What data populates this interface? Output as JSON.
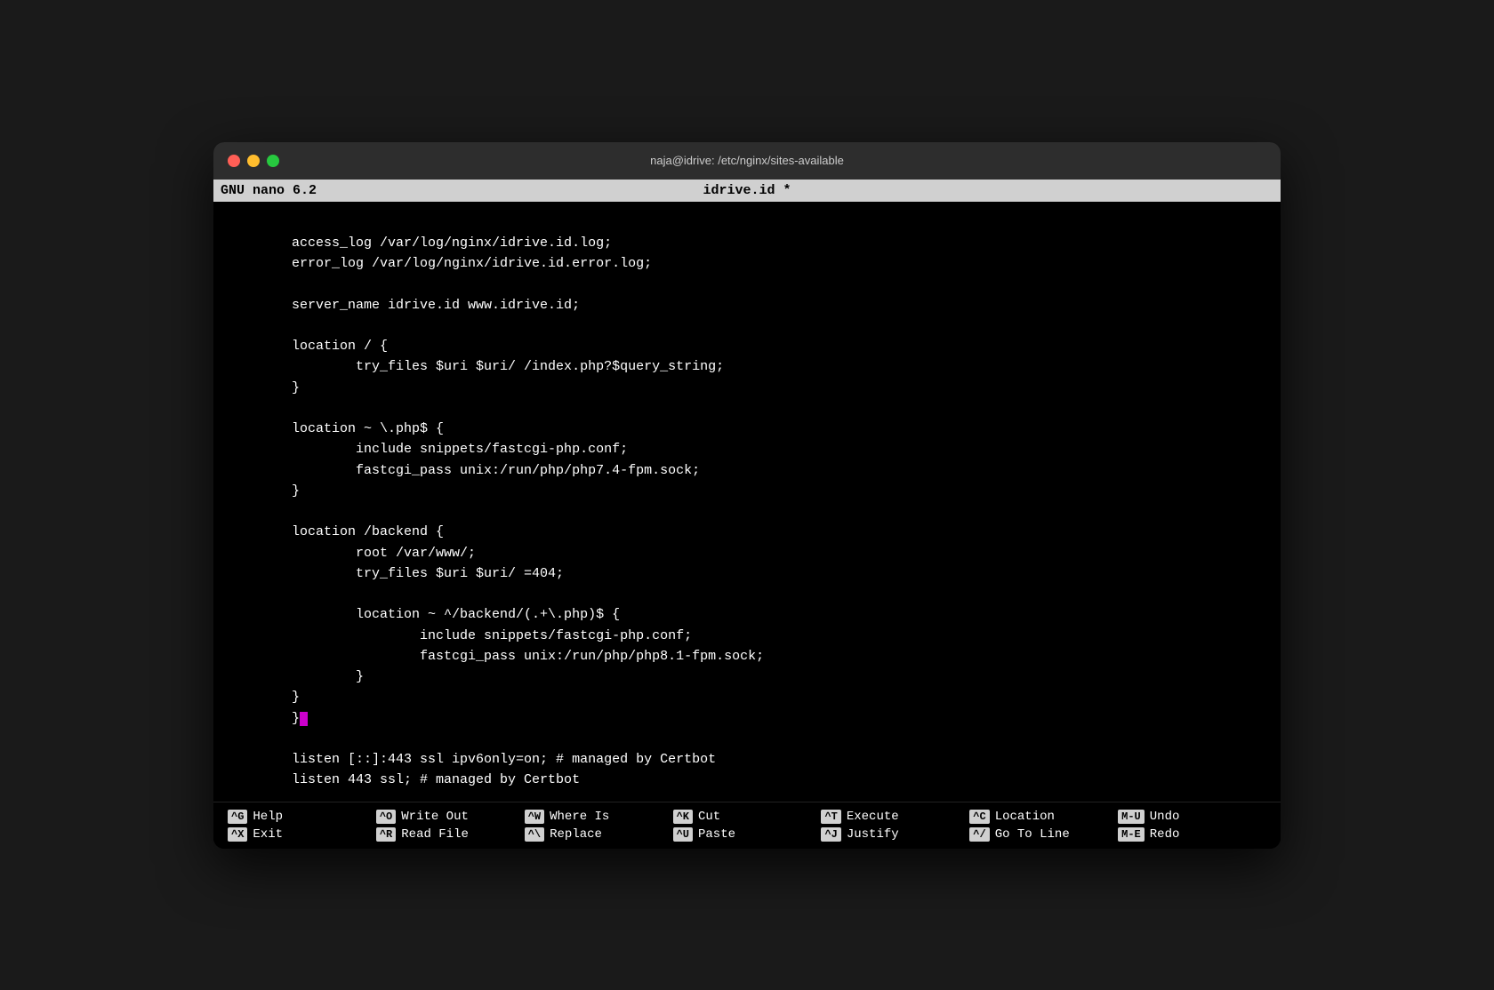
{
  "window": {
    "title": "naja@idrive: /etc/nginx/sites-available",
    "traffic_lights": [
      "close",
      "minimize",
      "maximize"
    ]
  },
  "nano_header": {
    "left": "GNU nano 6.2",
    "center": "idrive.id *",
    "right": ""
  },
  "editor": {
    "lines": [
      "        access_log /var/log/nginx/idrive.id.log;",
      "        error_log /var/log/nginx/idrive.id.error.log;",
      "",
      "        server_name idrive.id www.idrive.id;",
      "",
      "        location / {",
      "                try_files $uri $uri/ /index.php?$query_string;",
      "        }",
      "",
      "        location ~ \\.php$ {",
      "                include snippets/fastcgi-php.conf;",
      "                fastcgi_pass unix:/run/php/php7.4-fpm.sock;",
      "        }",
      "",
      "        location /backend {",
      "                root /var/www/;",
      "                try_files $uri $uri/ =404;",
      "",
      "                location ~ ^/backend/(.+\\.php)$ {",
      "                        include snippets/fastcgi-php.conf;",
      "                        fastcgi_pass unix:/run/php/php8.1-fpm.sock;",
      "                }",
      "        }"
    ],
    "cursor_line": "        }",
    "cursor_after": "}",
    "after_cursor_lines": [
      "",
      "        listen [::]:443 ssl ipv6only=on; # managed by Certbot",
      "        listen 443 ssl; # managed by Certbot"
    ]
  },
  "footer": {
    "rows": [
      [
        {
          "key": "^G",
          "label": "Help"
        },
        {
          "key": "^O",
          "label": "Write Out"
        },
        {
          "key": "^W",
          "label": "Where Is"
        },
        {
          "key": "^K",
          "label": "Cut"
        },
        {
          "key": "^T",
          "label": "Execute"
        },
        {
          "key": "^C",
          "label": "Location"
        },
        {
          "key": "M-U",
          "label": "Undo"
        }
      ],
      [
        {
          "key": "^X",
          "label": "Exit"
        },
        {
          "key": "^R",
          "label": "Read File"
        },
        {
          "key": "^\\",
          "label": "Replace"
        },
        {
          "key": "^U",
          "label": "Paste"
        },
        {
          "key": "^J",
          "label": "Justify"
        },
        {
          "key": "^/",
          "label": "Go To Line"
        },
        {
          "key": "M-E",
          "label": "Redo"
        }
      ]
    ]
  }
}
